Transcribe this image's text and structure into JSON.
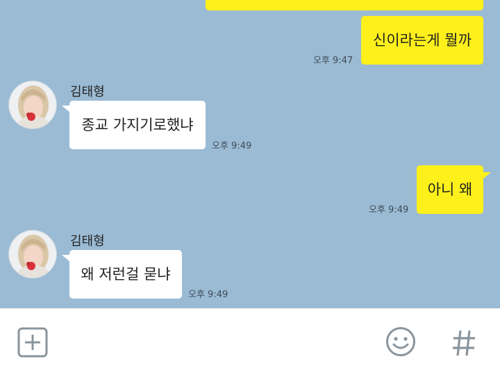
{
  "messages": [
    {
      "text": "신이라는게 뭘까",
      "time": "오후 9:47"
    },
    {
      "sender": "김태형",
      "text": "종교 가지기로했냐",
      "time": "오후 9:49"
    },
    {
      "text": "아니 왜",
      "time": "오후 9:49"
    },
    {
      "sender": "김태형",
      "text": "왜 저런걸 묻냐",
      "time": "오후 9:49"
    }
  ],
  "input_bar": {
    "icons": [
      "plus-square-icon",
      "emoji-smile-icon",
      "hash-icon"
    ]
  },
  "colors": {
    "chat_background": "#9bbbd4",
    "my_bubble": "#fef01b",
    "their_bubble": "#ffffff",
    "icon_gray": "#8a949c"
  }
}
